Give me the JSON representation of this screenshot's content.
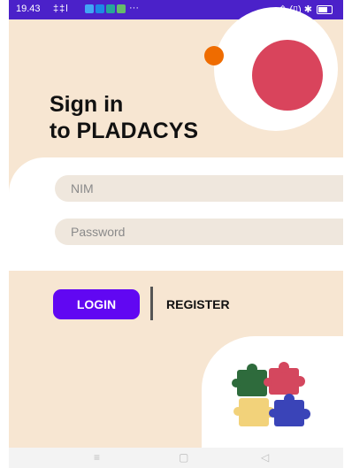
{
  "status_bar": {
    "time": "19.43",
    "signal": "‡‡l",
    "overflow": "···",
    "right_icons": "⇬ (▯) ✱",
    "app_icon_colors": [
      "#42a5f5",
      "#1e88e5",
      "#26a69a",
      "#66bb6a"
    ]
  },
  "title": {
    "line1": "Sign in",
    "line2": "to PLADACYS"
  },
  "form": {
    "nim_placeholder": "NIM",
    "password_placeholder": "Password"
  },
  "actions": {
    "login_label": "LOGIN",
    "register_label": "REGISTER"
  },
  "nav_bar": {
    "menu_glyph": "≡",
    "home_glyph": "▢",
    "back_glyph": "◁"
  },
  "colors": {
    "status_bar": "#4b21c9",
    "background": "#f7e6d2",
    "primary_button": "#6107f2",
    "accent_orange": "#ef6c00",
    "accent_pink": "#d9445c",
    "puzzle_green": "#2e6b3c",
    "puzzle_pink": "#d4475e",
    "puzzle_yellow": "#f2d27a",
    "puzzle_blue": "#3a44b8"
  }
}
